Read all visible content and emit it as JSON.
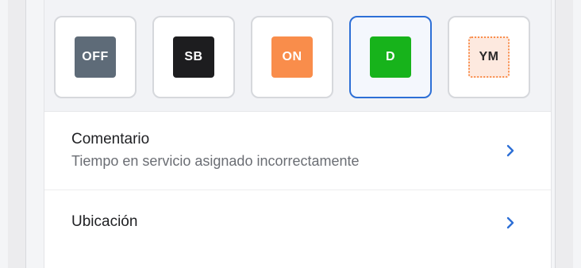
{
  "status_selector": {
    "options": [
      {
        "label": "OFF",
        "name": "status-off",
        "bg": "#5e6b78",
        "fg": "#ffffff",
        "selected": false
      },
      {
        "label": "SB",
        "name": "status-sb",
        "bg": "#1d1d1f",
        "fg": "#ffffff",
        "selected": false
      },
      {
        "label": "ON",
        "name": "status-on",
        "bg": "#f98d4b",
        "fg": "#ffffff",
        "selected": false
      },
      {
        "label": "D",
        "name": "status-d",
        "bg": "#17b31b",
        "fg": "#ffffff",
        "selected": true
      },
      {
        "label": "YM",
        "name": "status-ym",
        "bg": "#fde9df",
        "fg": "#2a2a2a",
        "selected": false,
        "dotted_border": "#f98d4b"
      }
    ],
    "selected_border_color": "#2d6fd6"
  },
  "comment_row": {
    "title": "Comentario",
    "subtitle": "Tiempo en servicio asignado incorrectamente",
    "chevron_icon": "chevron-right-icon"
  },
  "location_row": {
    "title": "Ubicación",
    "chevron_icon": "chevron-right-icon"
  },
  "colors": {
    "accent": "#2d6fd6"
  }
}
